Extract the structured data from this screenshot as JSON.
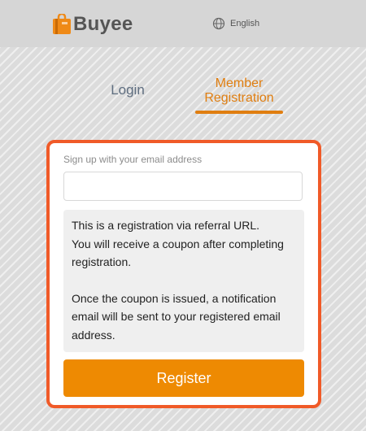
{
  "header": {
    "logo_text": "Buyee",
    "logo_icon": "shopping-bag-icon",
    "language_icon": "globe-icon",
    "language_label": "English"
  },
  "tabs": [
    {
      "label": "Login",
      "active": false
    },
    {
      "label_line1": "Member",
      "label_line2": "Registration",
      "active": true
    }
  ],
  "form": {
    "email_label": "Sign up with your email address",
    "email_value": "",
    "notice_line1": "This is a registration via referral URL.",
    "notice_line2": "You will receive a coupon after completing registration.",
    "notice_line3": "Once the coupon is issued, a notification email will be sent to your registered email address.",
    "register_label": "Register"
  },
  "colors": {
    "accent": "#ee8a02",
    "tab_active": "#e07e10",
    "highlight_border": "#f05a28",
    "tab_inactive": "#5f6e80"
  }
}
